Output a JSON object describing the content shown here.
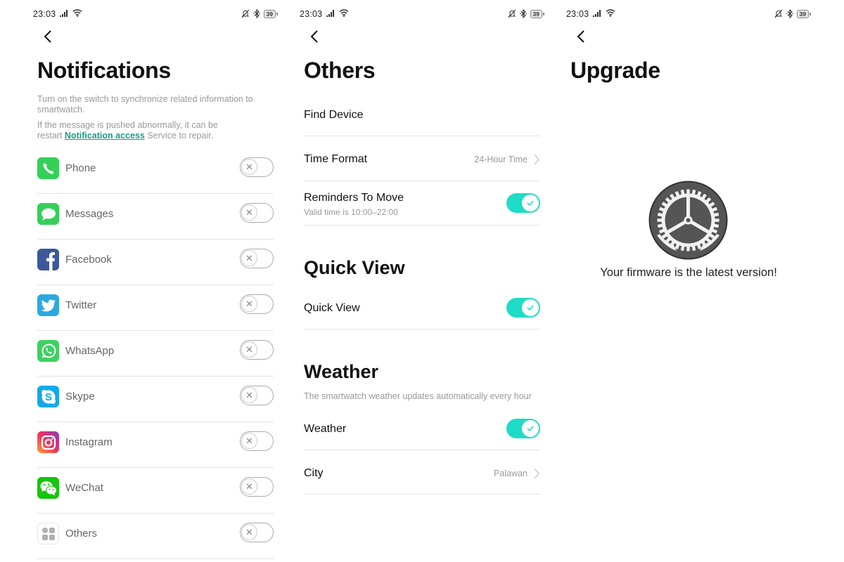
{
  "status_bar": {
    "time": "23:03",
    "battery": "39",
    "icons": [
      "signal-icon",
      "wifi-icon",
      "bell-off-icon",
      "bluetooth-icon",
      "battery-icon"
    ]
  },
  "notifications": {
    "title": "Notifications",
    "desc1": "Turn on the switch to synchronize related information to smartwatch.",
    "desc2_prefix": "If the message is pushed abnormally, it can be restart ",
    "desc2_link": "Notification access",
    "desc2_suffix": " Service to repair.",
    "apps": [
      {
        "label": "Phone",
        "icon": "phone-icon",
        "enabled": false
      },
      {
        "label": "Messages",
        "icon": "messages-icon",
        "enabled": false
      },
      {
        "label": "Facebook",
        "icon": "facebook-icon",
        "enabled": false
      },
      {
        "label": "Twitter",
        "icon": "twitter-icon",
        "enabled": false
      },
      {
        "label": "WhatsApp",
        "icon": "whatsapp-icon",
        "enabled": false
      },
      {
        "label": "Skype",
        "icon": "skype-icon",
        "enabled": false
      },
      {
        "label": "Instagram",
        "icon": "instagram-icon",
        "enabled": false
      },
      {
        "label": "WeChat",
        "icon": "wechat-icon",
        "enabled": false
      },
      {
        "label": "Others",
        "icon": "others-icon",
        "enabled": false
      }
    ]
  },
  "others": {
    "title": "Others",
    "find_device": "Find Device",
    "time_format": {
      "label": "Time Format",
      "value": "24-Hour Time"
    },
    "reminders": {
      "label": "Reminders To Move",
      "sub": "Valid time is 10:00–22:00",
      "enabled": true
    },
    "quick_view_section": "Quick View",
    "quick_view": {
      "label": "Quick View",
      "enabled": true
    },
    "weather_section": "Weather",
    "weather_desc": "The smartwatch weather updates automatically every hour",
    "weather": {
      "label": "Weather",
      "enabled": true
    },
    "city": {
      "label": "City",
      "value": "Palawan"
    }
  },
  "upgrade": {
    "title": "Upgrade",
    "message": "Your firmware is the latest version!"
  },
  "colors": {
    "accent_toggle": "#1fdcc7",
    "link": "#1a9b8a"
  }
}
